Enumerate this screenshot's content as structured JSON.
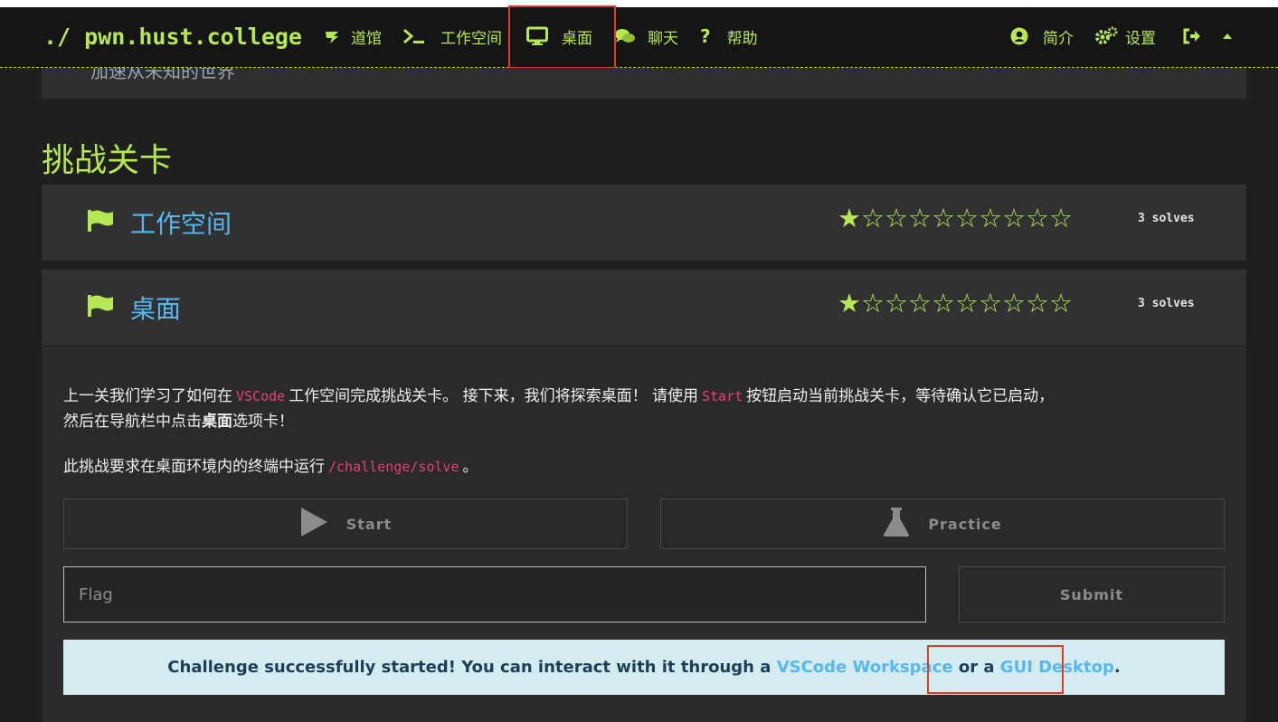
{
  "nav": {
    "brand": "./ pwn.hust.college",
    "dojos": "道馆",
    "workspace": "工作空间",
    "desktop": "桌面",
    "chat": "聊天",
    "help": "帮助",
    "profile": "简介",
    "settings": "设置"
  },
  "prev_text": "加速从未知的世界",
  "section_title": "挑战关卡",
  "challenges": [
    {
      "name": "工作空间",
      "stars": "★☆☆☆☆☆☆☆☆☆",
      "solves": "3 solves"
    },
    {
      "name": "桌面",
      "stars": "★☆☆☆☆☆☆☆☆☆",
      "solves": "3 solves"
    }
  ],
  "desc": {
    "p1_a": "上一关我们学习了如何在",
    "p1_code1": "VSCode",
    "p1_b": "工作空间完成挑战关卡。 接下来，我们将探索桌面！ 请使用",
    "p1_code2": "Start",
    "p1_c": "按钮启动当前挑战关卡，等待确认它已启动，",
    "p1_d": "然后在导航栏中点击",
    "p1_bold": "桌面",
    "p1_e": "选项卡！",
    "p2_a": "此挑战要求在桌面环境内的终端中运行",
    "p2_code": "/challenge/solve",
    "p2_b": "。"
  },
  "buttons": {
    "start": "Start",
    "practice": "Practice",
    "submit": "Submit"
  },
  "flag_placeholder": "Flag",
  "alert": {
    "text_a": "Challenge successfully started! You can interact with it through a",
    "link1": "VSCode Workspace",
    "text_b": "or a",
    "link2": "GUI Desktop",
    "text_c": "."
  },
  "colors": {
    "accent": "#b5e853",
    "link": "#57b7ef",
    "code": "#e8407a",
    "highlight": "#e23a23"
  }
}
